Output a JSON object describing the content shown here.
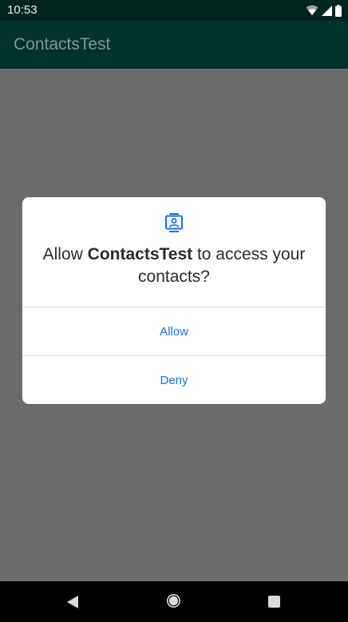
{
  "status_bar": {
    "time": "10:53",
    "icons": [
      "wifi-icon",
      "signal-icon",
      "battery-icon"
    ]
  },
  "app_bar": {
    "title": "ContactsTest"
  },
  "dialog": {
    "icon": "contacts-icon",
    "message_prefix": "Allow ",
    "app_name": "ContactsTest",
    "message_suffix": " to access your contacts?",
    "allow_label": "Allow",
    "deny_label": "Deny"
  },
  "nav_bar": {
    "icons": [
      "back-icon",
      "home-icon",
      "recents-icon"
    ]
  },
  "colors": {
    "status_bar": "#00251f",
    "app_bar": "#00332b",
    "scrim": "#6b6b6b",
    "button_text": "#1a73e8",
    "icon_blue": "#1a73e8"
  }
}
